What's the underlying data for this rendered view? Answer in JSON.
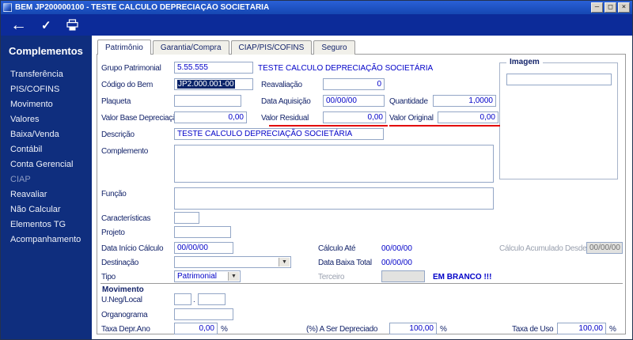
{
  "colors": {
    "titlebar_blue": "#1c55c6",
    "toolbar_blue": "#0c2b99",
    "sidebar_navy": "#0f2e7e",
    "field_value_blue": "#0000c8",
    "underline_red": "#e30000",
    "selection_navy": "#0a246a"
  },
  "window": {
    "title": "BEM JP200000100 - TESTE CALCULO DEPRECIAÇÃO SOCIETÁRIA",
    "controls": {
      "minimize": "–",
      "maximize": "□",
      "close": "×"
    }
  },
  "toolbar": {
    "back_icon": "←",
    "confirm_icon": "✓",
    "print_icon": "printer"
  },
  "sidebar": {
    "heading": "Complementos",
    "items": [
      {
        "label": "Transferência"
      },
      {
        "label": "PIS/COFINS"
      },
      {
        "label": "Movimento"
      },
      {
        "label": "Valores"
      },
      {
        "label": "Baixa/Venda"
      },
      {
        "label": "Contábil"
      },
      {
        "label": "Conta Gerencial"
      },
      {
        "label": "CIAP",
        "state": "selected"
      },
      {
        "label": "Reavaliar"
      },
      {
        "label": "Não Calcular"
      },
      {
        "label": "Elementos TG"
      },
      {
        "label": "Acompanhamento"
      }
    ]
  },
  "tabs": [
    {
      "label": "Patrimônio",
      "active": true
    },
    {
      "label": "Garantia/Compra",
      "active": false
    },
    {
      "label": "CIAP/PIS/COFINS",
      "active": false
    },
    {
      "label": "Seguro",
      "active": false
    }
  ],
  "form": {
    "grupo_patrimonial": {
      "label": "Grupo Patrimonial",
      "value": "5.55.555",
      "description": "TESTE CALCULO DEPRECIAÇÃO SOCIETÁRIA"
    },
    "codigo_do_bem": {
      "label": "Código do Bem",
      "value": "JP2.000.001-00"
    },
    "reavaliacao": {
      "label": "Reavaliação",
      "value": "0"
    },
    "plaqueta": {
      "label": "Plaqueta",
      "value": ""
    },
    "data_aquisicao": {
      "label": "Data Aquisição",
      "value": "00/00/00"
    },
    "quantidade": {
      "label": "Quantidade",
      "value": "1,0000"
    },
    "valor_base_depreciacao": {
      "label": "Valor Base Depreciação",
      "value": "0,00"
    },
    "valor_residual": {
      "label": "Valor Residual",
      "value": "0,00"
    },
    "valor_original": {
      "label": "Valor Original",
      "value": "0,00"
    },
    "descricao": {
      "label": "Descrição",
      "value": "TESTE CALCULO DEPRECIAÇÃO SOCIETÁRIA"
    },
    "complemento": {
      "label": "Complemento",
      "value": ""
    },
    "funcao": {
      "label": "Função",
      "value": ""
    },
    "caracteristicas": {
      "label": "Características",
      "value": ""
    },
    "projeto": {
      "label": "Projeto",
      "value": ""
    },
    "data_inicio_calculo": {
      "label": "Data Início Cálculo",
      "value": "00/00/00"
    },
    "calculo_ate": {
      "label": "Cálculo Até",
      "value": "00/00/00"
    },
    "calculo_acumulado_desde": {
      "label": "Cálculo Acumulado Desde",
      "value": "00/00/00"
    },
    "destinacao": {
      "label": "Destinação",
      "value": ""
    },
    "data_baixa_total": {
      "label": "Data Baixa Total",
      "value": "00/00/00"
    },
    "tipo": {
      "label": "Tipo",
      "value": "Patrimonial"
    },
    "terceiro": {
      "label": "Terceiro",
      "value": "",
      "note": "EM BRANCO !!!"
    },
    "imagem": {
      "label": "Imagem",
      "value": ""
    }
  },
  "movimento": {
    "heading": "Movimento",
    "u_neg_local": {
      "label": "U.Neg/Local",
      "value1": "",
      "separator": ".",
      "value2": ""
    },
    "organograma": {
      "label": "Organograma",
      "value": ""
    },
    "taxa_depr_ano": {
      "label": "Taxa Depr.Ano",
      "value": "0,00",
      "unit": "%"
    },
    "a_ser_depreciado": {
      "label": "(%) A Ser Depreciado",
      "value": "100,00",
      "unit": "%"
    },
    "taxa_de_uso": {
      "label": "Taxa de Uso",
      "value": "100,00",
      "unit": "%"
    }
  }
}
